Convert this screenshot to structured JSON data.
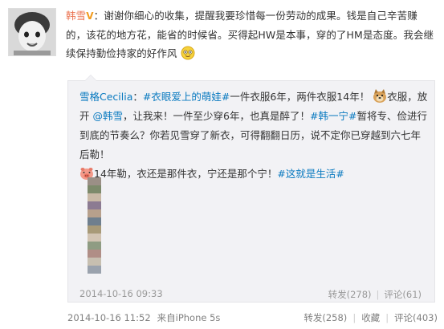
{
  "post": {
    "author": "韩雪",
    "badge": "V",
    "colon": "：",
    "text": "谢谢你细心的收集，提醒我要珍惜每一份劳动的成果。钱是自己辛苦赚的，该花的地方花，能省的时候省。买得起HW是本事，穿的了HM是态度。我会继续保持勤俭持家的好作风",
    "time": "2014-10-16 11:52",
    "source": "来自iPhone 5s",
    "actions": {
      "repost": "转发(258)",
      "favorite": "收藏",
      "comment": "评论(403)"
    }
  },
  "quote": {
    "author": "雪格Cecilia",
    "colon": "：",
    "topic1": "#衣眼爱上的萌娃#",
    "text1": "一件衣服6年，两件衣服14年！",
    "text2": "衣服，放开",
    "mention": "@韩雪",
    "text3": "，让我来！一件至少穿6年，也真是醉了！",
    "topic2": "#韩一宁#",
    "text4": "暂将专、俭进行到底的节奏么？你若见雪穿了新衣，可得翻翻日历，说不定你已穿越到六七年后勒！",
    "text5": "14年勒，衣还是那件衣，宁还是那个宁！",
    "topic3": "#这就是生活#",
    "time": "2014-10-16 09:33",
    "actions": {
      "repost": "转发(278)",
      "comment": "评论(61)"
    }
  },
  "colors": {
    "author": "#eb7350",
    "link": "#0a7ac0",
    "quote_bg": "#f2f2f5",
    "meta": "#808080"
  },
  "icons": [
    "avatar",
    "verified-badge-icon",
    "smile-emoji-icon",
    "doge-emoji-icon",
    "pig-emoji-icon",
    "image-thumbnail"
  ]
}
